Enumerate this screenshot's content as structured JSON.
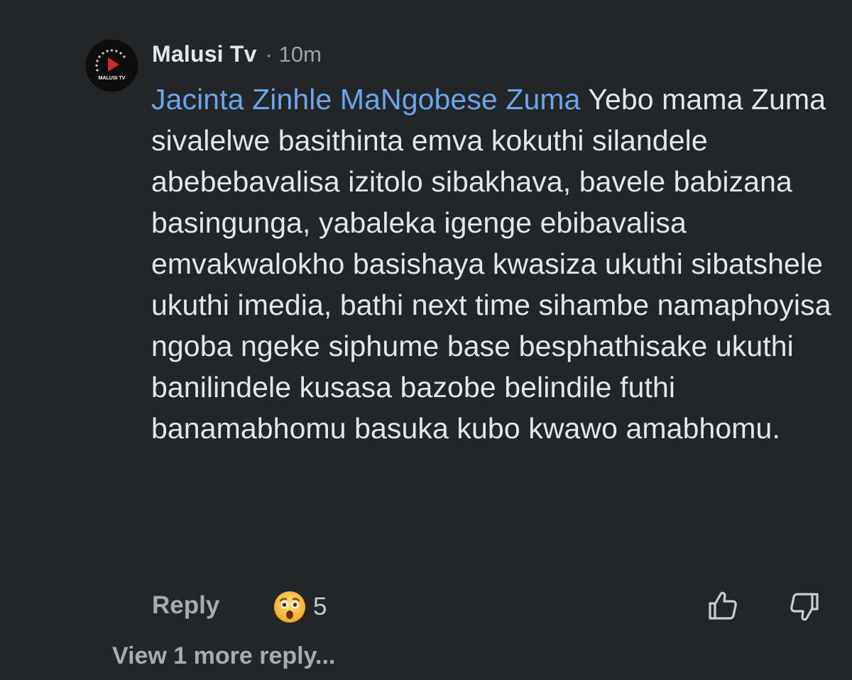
{
  "comment": {
    "author": "Malusi Tv",
    "separator": "·",
    "time": "10m",
    "avatar_icon": "malusi-tv-logo",
    "avatar_logo_text": "MALUSI TV",
    "mention": "Jacinta Zinhle MaNgobese Zuma",
    "text": "Yebo mama Zuma sivalelwe basithinta emva kokuthi silandele abebebavalisa izitolo sibakhava, bavele babizana basingunga, yabaleka igenge ebibavalisa emvakwalokho basishaya kwasiza ukuthi sibatshele ukuthi imedia, bathi next time sihambe namaphoyisa ngoba ngeke siphume base besphathisake ukuthi banilindele kusasa bazobe belindile futhi banamabhomu basuka kubo kwawo amabhomu."
  },
  "actions": {
    "reply_label": "Reply",
    "reaction_icon": "astonished-face-emoji",
    "reaction_count": "5",
    "like_icon": "thumbs-up-icon",
    "dislike_icon": "thumbs-down-icon"
  },
  "view_more_label": "View 1 more reply...",
  "colors": {
    "background": "#242526",
    "text": "#e4e6eb",
    "secondary": "#a0a3a8",
    "mention": "#6aa6ee"
  }
}
